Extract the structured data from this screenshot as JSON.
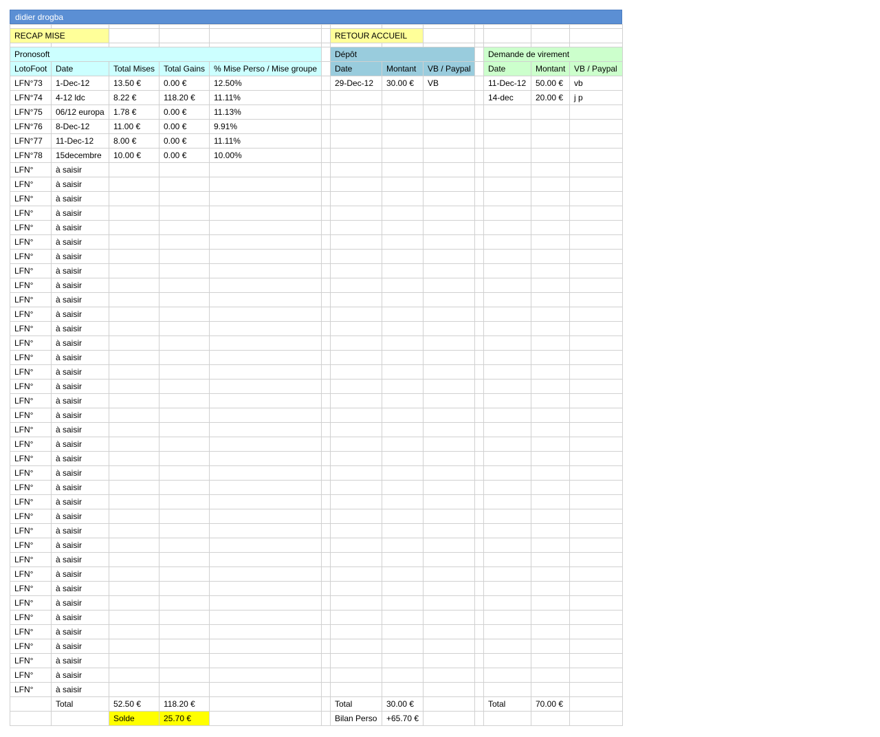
{
  "title": "didier drogba",
  "nav": {
    "recap_label": "RECAP MISE",
    "retour_label": "RETOUR ACCUEIL"
  },
  "sections": {
    "pronosoft": "Pronosoft",
    "depot": "Dépôt",
    "virement": "Demande de virement"
  },
  "headers": {
    "pronosoft": [
      "LotoFoot",
      "Date",
      "Total Mises",
      "Total Gains",
      "% Mise Perso / Mise groupe"
    ],
    "depot": [
      "Date",
      "Montant",
      "VB / Paypal"
    ],
    "virement": [
      "Date",
      "Montant",
      "VB / Paypal"
    ]
  },
  "pronosoft_rows": [
    [
      "LFN°73",
      "1-Dec-12",
      "13.50 €",
      "0.00 €",
      "12.50%"
    ],
    [
      "LFN°74",
      "4-12 ldc",
      "8.22 €",
      "118.20 €",
      "11.11%"
    ],
    [
      "LFN°75",
      "06/12 europa",
      "1.78 €",
      "0.00 €",
      "11.13%"
    ],
    [
      "LFN°76",
      "8-Dec-12",
      "11.00 €",
      "0.00 €",
      "9.91%"
    ],
    [
      "LFN°77",
      "11-Dec-12",
      "8.00 €",
      "0.00 €",
      "11.11%"
    ],
    [
      "LFN°78",
      "15decembre",
      "10.00 €",
      "0.00 €",
      "10.00%"
    ]
  ],
  "placeholder_row": {
    "lotofoot": "LFN°",
    "date": "à saisir"
  },
  "depot_rows": [
    [
      "29-Dec-12",
      "30.00 €",
      "VB"
    ]
  ],
  "virement_rows": [
    [
      "11-Dec-12",
      "50.00 €",
      "vb"
    ],
    [
      "14-dec",
      "20.00 €",
      "j p"
    ]
  ],
  "totals": {
    "pronosoft_label": "Total",
    "total_mises": "52.50 €",
    "total_gains": "118.20 €",
    "solde_label": "Solde",
    "solde_value": "25.70 €",
    "depot_label": "Total",
    "depot_value": "30.00 €",
    "bilan_label": "Bilan Perso",
    "bilan_value": "+65.70 €",
    "virement_label": "Total",
    "virement_value": "70.00 €"
  },
  "colors": {
    "title_bar": "#5b8fd4",
    "nav_yellow": "#ffff99",
    "pronosoft_cyan": "#ccffff",
    "depot_blue": "#99ccdd",
    "virement_green": "#ccffcc",
    "solde_yellow": "#ffff00"
  }
}
